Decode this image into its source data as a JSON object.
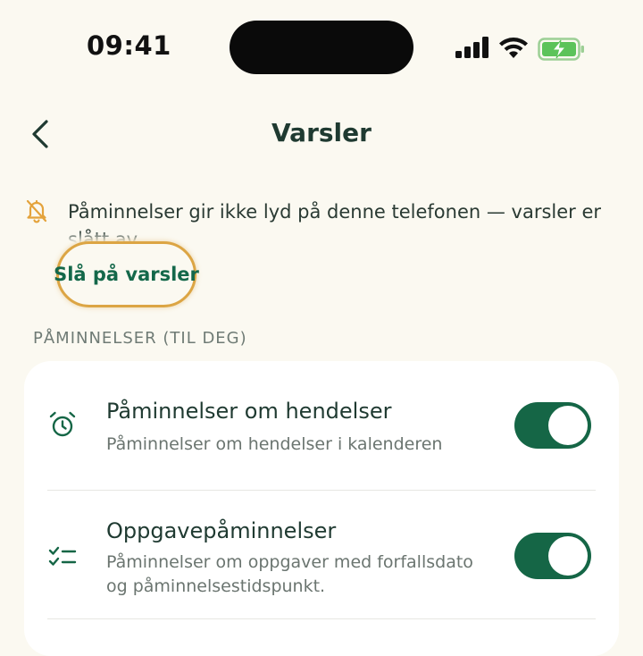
{
  "status_bar": {
    "time": "09:41",
    "icons": [
      "cellular-signal-icon",
      "wifi-icon",
      "battery-charging-icon"
    ],
    "battery_color": "#5cc35a"
  },
  "header": {
    "back_icon": "chevron-left-icon",
    "title": "Varsler"
  },
  "notice": {
    "icon": "bell-off-icon",
    "icon_color": "#e4a33c",
    "text": "Påminnelser gir ikke lyd på denne telefonen — varsler er slått av.",
    "action_label": "Slå på varsler",
    "highlight_color": "#dca544"
  },
  "section": {
    "header": "PÅMINNELSER (TIL DEG)",
    "items": [
      {
        "icon": "alarm-clock-icon",
        "title": "Påminnelser om hendelser",
        "subtitle": "Påminnelser om hendelser i kalenderen",
        "enabled": true
      },
      {
        "icon": "checklist-icon",
        "title": "Oppgavepåminnelser",
        "subtitle": "Påminnelser om oppgaver med forfallsdato og påminnelsestidspunkt.",
        "enabled": true
      }
    ]
  },
  "colors": {
    "background": "#fbf9f1",
    "accent": "#156646",
    "text": "#1f3a31"
  }
}
